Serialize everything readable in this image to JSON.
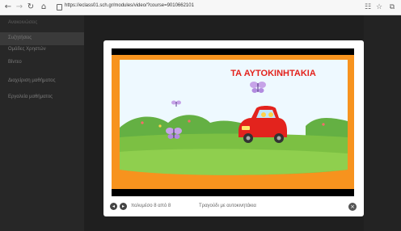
{
  "browser": {
    "url": "https://eclass01.sch.gr/modules/video/?course=9010662101"
  },
  "sidebar": {
    "items": [
      {
        "label": "Ανακοινώσεις"
      },
      {
        "label": "Συζητήσεις"
      },
      {
        "label": "Ομάδες Χρηστών"
      },
      {
        "label": "Βίντεο"
      },
      {
        "label": "Διαχείριση μαθήματος"
      },
      {
        "label": "Εργαλεία μαθήματος"
      }
    ]
  },
  "player": {
    "video_title": "ΤΑ ΑΥΤΟΚΙΝΗΤΑΚΙΑ",
    "counter": "πολυμέσο 8 από 8",
    "caption": "Τραγούδι με αυτοκινητάκια"
  },
  "colors": {
    "frame_orange": "#f7931e",
    "title_red": "#e3231d",
    "grass": "#7cc043",
    "sky": "#eef9ff"
  }
}
